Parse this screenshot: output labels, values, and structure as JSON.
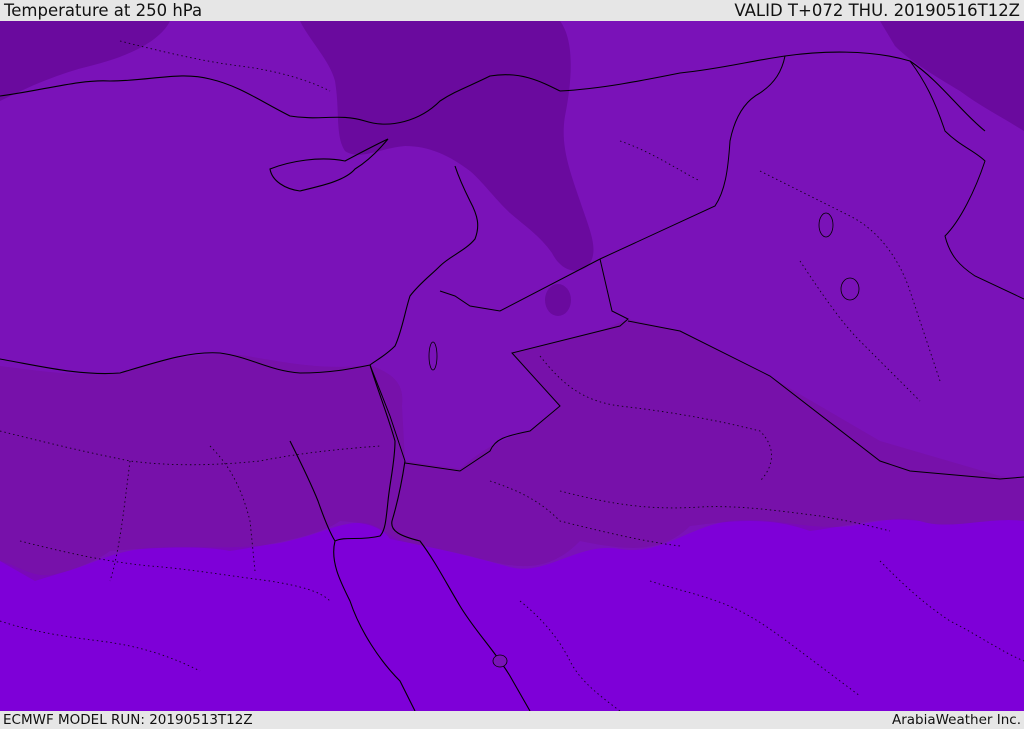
{
  "header": {
    "title": "Temperature at 250 hPa",
    "valid": "VALID T+072 THU. 20190516T12Z"
  },
  "footer": {
    "model_run": "ECMWF MODEL RUN: 20190513T12Z",
    "credit": "ArabiaWeather Inc."
  },
  "colors": {
    "band_cold": "#6a0a9e",
    "band_mid": "#7a12b8",
    "band_warm": "#7e00d8",
    "land_overlay": "#75109f",
    "boundary": "#000000",
    "bar_background": "#e6e6e6"
  },
  "map": {
    "parameter": "Temperature",
    "level": "250 hPa",
    "region": "Eastern Mediterranean / Middle East"
  }
}
